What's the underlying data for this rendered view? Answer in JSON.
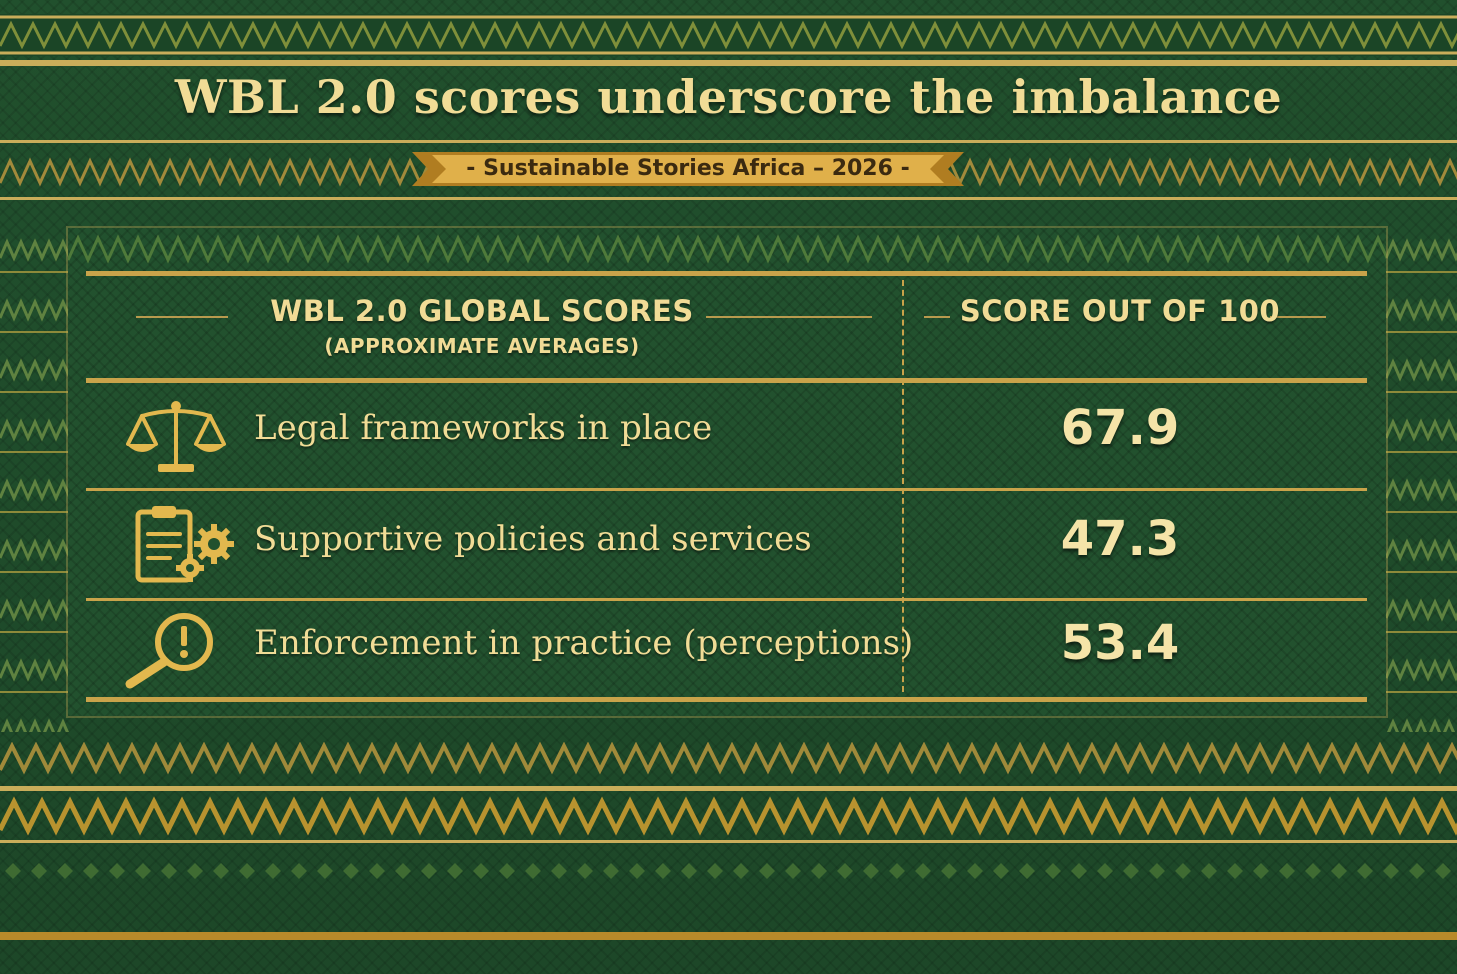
{
  "header": {
    "title": "WBL 2.0 scores underscore the imbalance",
    "ribbon": "- Sustainable Stories Africa – 2026 -"
  },
  "table": {
    "left_header": "WBL 2.0 GLOBAL SCORES",
    "left_subheader": "(APPROXIMATE AVERAGES)",
    "right_header": "SCORE OUT OF 100",
    "rows": [
      {
        "label": "Legal frameworks in place",
        "value": "67.9",
        "icon": "scales-icon"
      },
      {
        "label": "Supportive policies and services",
        "value": "47.3",
        "icon": "clipboard-gears-icon"
      },
      {
        "label": "Enforcement in practice (perceptions)",
        "value": "53.4",
        "icon": "magnifier-alert-icon"
      }
    ]
  },
  "colors": {
    "background": "#21502d",
    "gold": "#c9a34a",
    "text": "#f1dc96"
  }
}
